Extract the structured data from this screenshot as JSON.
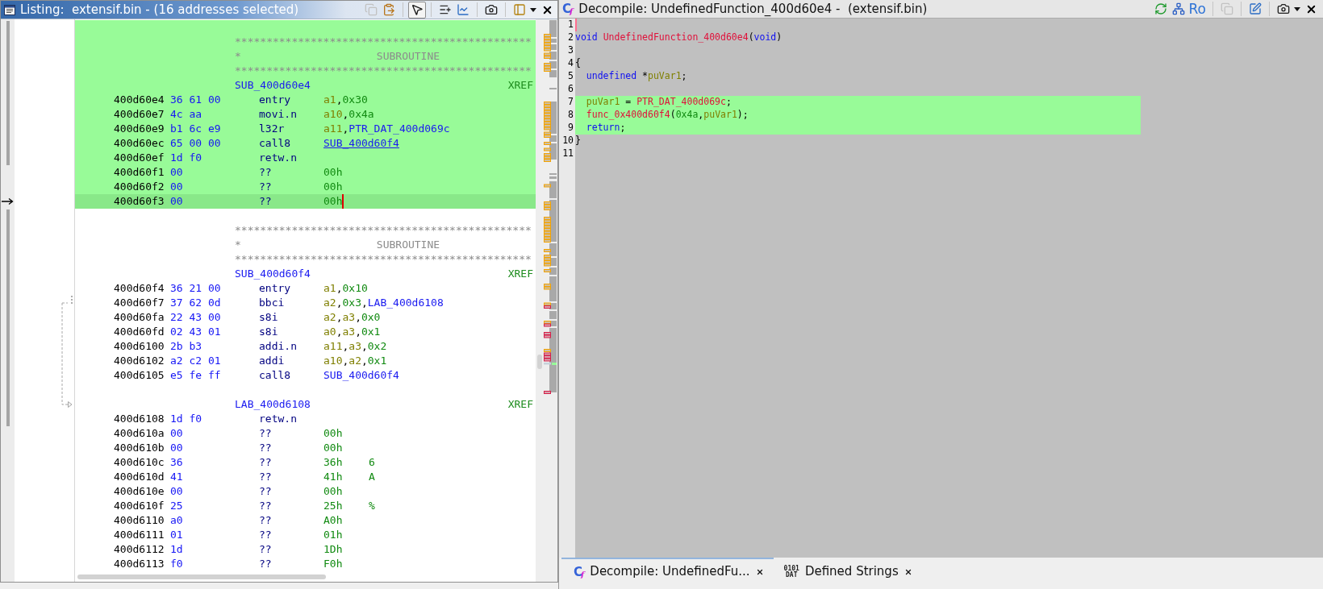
{
  "listing": {
    "title": "Listing:  extensif.bin - (16 addresses selected)",
    "toolbar": [
      {
        "disabled": true,
        "pressed": false
      },
      {
        "disabled": false,
        "pressed": false
      },
      {
        "disabled": false,
        "pressed": true
      },
      {
        "disabled": false,
        "pressed": false
      },
      {
        "disabled": false,
        "pressed": false
      },
      {
        "disabled": false,
        "pressed": false
      },
      {
        "disabled": false,
        "pressed": false
      },
      {
        "disabled": false,
        "pressed": false
      },
      {
        "disabled": false,
        "pressed": false
      }
    ],
    "lines": [
      {
        "kind": "blank",
        "selected": true,
        "cursor": false
      },
      {
        "kind": "stars",
        "text": "***********************************************",
        "selected": true,
        "cursor": false
      },
      {
        "kind": "title",
        "mark": "*",
        "text": "SUBROUTINE",
        "selected": true,
        "cursor": false
      },
      {
        "kind": "stars",
        "text": "***********************************************",
        "selected": true,
        "cursor": false
      },
      {
        "kind": "label",
        "label": "SUB_400d60e4",
        "xref": "XREF",
        "selected": true,
        "cursor": false
      },
      {
        "kind": "code",
        "address": "400d60e4",
        "bytes": "36 61 00",
        "mnemonic": "entry",
        "operands": [
          {
            "kind": "register",
            "text": "a1"
          },
          {
            "kind": "separator",
            "text": ","
          },
          {
            "kind": "scalar",
            "text": "0x30"
          }
        ],
        "selected": true,
        "cursor": false
      },
      {
        "kind": "code",
        "address": "400d60e7",
        "bytes": "4c aa",
        "mnemonic": "movi.n",
        "operands": [
          {
            "kind": "register",
            "text": "a10"
          },
          {
            "kind": "separator",
            "text": ","
          },
          {
            "kind": "scalar",
            "text": "0x4a"
          }
        ],
        "selected": true,
        "cursor": false
      },
      {
        "kind": "code",
        "address": "400d60e9",
        "bytes": "b1 6c e9",
        "mnemonic": "l32r",
        "operands": [
          {
            "kind": "register",
            "text": "a11"
          },
          {
            "kind": "separator",
            "text": ","
          },
          {
            "kind": "label",
            "text": "PTR_DAT_400d069c"
          }
        ],
        "selected": true,
        "cursor": false
      },
      {
        "kind": "code",
        "address": "400d60ec",
        "bytes": "65 00 00",
        "mnemonic": "call8",
        "operands": [
          {
            "kind": "link",
            "text": "SUB_400d60f4"
          }
        ],
        "selected": true,
        "cursor": false
      },
      {
        "kind": "code",
        "address": "400d60ef",
        "bytes": "1d f0",
        "mnemonic": "retw.n",
        "selected": true,
        "cursor": false
      },
      {
        "kind": "code",
        "address": "400d60f1",
        "bytes": "00",
        "mnemonic": "??",
        "operands": [
          {
            "kind": "scalar",
            "text": "00h"
          }
        ],
        "selected": true,
        "cursor": false
      },
      {
        "kind": "code",
        "address": "400d60f2",
        "bytes": "00",
        "mnemonic": "??",
        "operands": [
          {
            "kind": "scalar",
            "text": "00h"
          }
        ],
        "selected": true,
        "cursor": false
      },
      {
        "kind": "code",
        "address": "400d60f3",
        "bytes": "00",
        "mnemonic": "??",
        "operands": [
          {
            "kind": "scalar",
            "text": "00h"
          }
        ],
        "selected": true,
        "cursor": true
      },
      {
        "kind": "blank",
        "selected": false,
        "cursor": false
      },
      {
        "kind": "stars",
        "text": "***********************************************",
        "selected": false,
        "cursor": false
      },
      {
        "kind": "title",
        "mark": "*",
        "text": "SUBROUTINE",
        "selected": false,
        "cursor": false
      },
      {
        "kind": "stars",
        "text": "***********************************************",
        "selected": false,
        "cursor": false
      },
      {
        "kind": "label",
        "label": "SUB_400d60f4",
        "xref": "XREF",
        "selected": false,
        "cursor": false
      },
      {
        "kind": "code",
        "address": "400d60f4",
        "bytes": "36 21 00",
        "mnemonic": "entry",
        "operands": [
          {
            "kind": "register",
            "text": "a1"
          },
          {
            "kind": "separator",
            "text": ","
          },
          {
            "kind": "scalar",
            "text": "0x10"
          }
        ],
        "selected": false,
        "cursor": false
      },
      {
        "kind": "code",
        "address": "400d60f7",
        "bytes": "37 62 0d",
        "mnemonic": "bbci",
        "operands": [
          {
            "kind": "register",
            "text": "a2"
          },
          {
            "kind": "separator",
            "text": ","
          },
          {
            "kind": "scalar",
            "text": "0x3"
          },
          {
            "kind": "separator",
            "text": ","
          },
          {
            "kind": "label",
            "text": "LAB_400d6108"
          }
        ],
        "selected": false,
        "cursor": false
      },
      {
        "kind": "code",
        "address": "400d60fa",
        "bytes": "22 43 00",
        "mnemonic": "s8i",
        "operands": [
          {
            "kind": "register",
            "text": "a2"
          },
          {
            "kind": "separator",
            "text": ","
          },
          {
            "kind": "register",
            "text": "a3"
          },
          {
            "kind": "separator",
            "text": ","
          },
          {
            "kind": "scalar",
            "text": "0x0"
          }
        ],
        "selected": false,
        "cursor": false
      },
      {
        "kind": "code",
        "address": "400d60fd",
        "bytes": "02 43 01",
        "mnemonic": "s8i",
        "operands": [
          {
            "kind": "register",
            "text": "a0"
          },
          {
            "kind": "separator",
            "text": ","
          },
          {
            "kind": "register",
            "text": "a3"
          },
          {
            "kind": "separator",
            "text": ","
          },
          {
            "kind": "scalar",
            "text": "0x1"
          }
        ],
        "selected": false,
        "cursor": false
      },
      {
        "kind": "code",
        "address": "400d6100",
        "bytes": "2b b3",
        "mnemonic": "addi.n",
        "operands": [
          {
            "kind": "register",
            "text": "a11"
          },
          {
            "kind": "separator",
            "text": ","
          },
          {
            "kind": "register",
            "text": "a3"
          },
          {
            "kind": "separator",
            "text": ","
          },
          {
            "kind": "scalar",
            "text": "0x2"
          }
        ],
        "selected": false,
        "cursor": false
      },
      {
        "kind": "code",
        "address": "400d6102",
        "bytes": "a2 c2 01",
        "mnemonic": "addi",
        "operands": [
          {
            "kind": "register",
            "text": "a10"
          },
          {
            "kind": "separator",
            "text": ","
          },
          {
            "kind": "register",
            "text": "a2"
          },
          {
            "kind": "separator",
            "text": ","
          },
          {
            "kind": "scalar",
            "text": "0x1"
          }
        ],
        "selected": false,
        "cursor": false
      },
      {
        "kind": "code",
        "address": "400d6105",
        "bytes": "e5 fe ff",
        "mnemonic": "call8",
        "operands": [
          {
            "kind": "label",
            "text": "SUB_400d60f4"
          }
        ],
        "selected": false,
        "cursor": false
      },
      {
        "kind": "blank",
        "selected": false,
        "cursor": false
      },
      {
        "kind": "label",
        "label": "LAB_400d6108",
        "xref": "XREF",
        "selected": false,
        "cursor": false
      },
      {
        "kind": "code",
        "address": "400d6108",
        "bytes": "1d f0",
        "mnemonic": "retw.n",
        "selected": false,
        "cursor": false
      },
      {
        "kind": "code",
        "address": "400d610a",
        "bytes": "00",
        "mnemonic": "??",
        "operands": [
          {
            "kind": "scalar",
            "text": "00h"
          }
        ],
        "selected": false,
        "cursor": false
      },
      {
        "kind": "code",
        "address": "400d610b",
        "bytes": "00",
        "mnemonic": "??",
        "operands": [
          {
            "kind": "scalar",
            "text": "00h"
          }
        ],
        "selected": false,
        "cursor": false
      },
      {
        "kind": "code",
        "address": "400d610c",
        "bytes": "36",
        "mnemonic": "??",
        "operands": [
          {
            "kind": "scalar",
            "text": "36h"
          }
        ],
        "char": "6",
        "selected": false,
        "cursor": false
      },
      {
        "kind": "code",
        "address": "400d610d",
        "bytes": "41",
        "mnemonic": "??",
        "operands": [
          {
            "kind": "scalar",
            "text": "41h"
          }
        ],
        "char": "A",
        "selected": false,
        "cursor": false
      },
      {
        "kind": "code",
        "address": "400d610e",
        "bytes": "00",
        "mnemonic": "??",
        "operands": [
          {
            "kind": "scalar",
            "text": "00h"
          }
        ],
        "selected": false,
        "cursor": false
      },
      {
        "kind": "code",
        "address": "400d610f",
        "bytes": "25",
        "mnemonic": "??",
        "operands": [
          {
            "kind": "scalar",
            "text": "25h"
          }
        ],
        "char": "%",
        "selected": false,
        "cursor": false
      },
      {
        "kind": "code",
        "address": "400d6110",
        "bytes": "a0",
        "mnemonic": "??",
        "operands": [
          {
            "kind": "scalar",
            "text": "A0h"
          }
        ],
        "selected": false,
        "cursor": false
      },
      {
        "kind": "code",
        "address": "400d6111",
        "bytes": "01",
        "mnemonic": "??",
        "operands": [
          {
            "kind": "scalar",
            "text": "01h"
          }
        ],
        "selected": false,
        "cursor": false
      },
      {
        "kind": "code",
        "address": "400d6112",
        "bytes": "1d",
        "mnemonic": "??",
        "operands": [
          {
            "kind": "scalar",
            "text": "1Dh"
          }
        ],
        "selected": false,
        "cursor": false
      },
      {
        "kind": "code",
        "address": "400d6113",
        "bytes": "f0",
        "mnemonic": "??",
        "operands": [
          {
            "kind": "scalar",
            "text": "F0h"
          }
        ],
        "selected": false,
        "cursor": false
      }
    ]
  },
  "decompile": {
    "icon": {
      "kind": "letters",
      "letter": "C",
      "sub": "f"
    },
    "title": "Decompile: UndefinedFunction_400d60e4 -  (extensif.bin)",
    "toolbar": [
      {
        "disabled": false
      },
      {
        "disabled": false
      },
      {
        "label": "Ro",
        "disabled": false
      },
      {
        "disabled": true
      },
      {
        "disabled": false
      },
      {
        "disabled": false
      },
      {
        "disabled": false
      },
      {
        "disabled": false
      }
    ],
    "lines": [
      {
        "number": "1",
        "selected": false,
        "cursor": true
      },
      {
        "number": "2",
        "tokens": [
          {
            "kind": "keyword",
            "text": "void "
          },
          {
            "kind": "function",
            "text": "UndefinedFunction_400d60e4"
          },
          {
            "kind": "plain",
            "text": "("
          },
          {
            "kind": "keyword",
            "text": "void"
          },
          {
            "kind": "plain",
            "text": ")"
          }
        ],
        "selected": false,
        "cursor": false
      },
      {
        "number": "3",
        "selected": false,
        "cursor": false
      },
      {
        "number": "4",
        "tokens": [
          {
            "kind": "plain",
            "text": "{"
          }
        ],
        "selected": false,
        "cursor": false,
        "children": [
          {
            "number": "5",
            "tokens": [
              {
                "kind": "keyword",
                "text": "undefined"
              },
              {
                "kind": "plain",
                "text": " *"
              },
              {
                "kind": "variable",
                "text": "puVar1"
              },
              {
                "kind": "plain",
                "text": ";"
              }
            ],
            "selected": false,
            "cursor": false
          },
          {
            "number": "6",
            "selected": false,
            "cursor": false
          },
          {
            "number": "7",
            "tokens": [
              {
                "kind": "variable",
                "text": "puVar1"
              },
              {
                "kind": "plain",
                "text": " = "
              },
              {
                "kind": "global",
                "text": "PTR_DAT_400d069c"
              },
              {
                "kind": "plain",
                "text": ";"
              }
            ],
            "selected": true,
            "cursor": false
          },
          {
            "number": "8",
            "tokens": [
              {
                "kind": "function",
                "text": "func_0x400d60f4"
              },
              {
                "kind": "plain",
                "text": "("
              },
              {
                "kind": "constant",
                "text": "0x4a"
              },
              {
                "kind": "plain",
                "text": ","
              },
              {
                "kind": "variable",
                "text": "puVar1"
              },
              {
                "kind": "plain",
                "text": ");"
              }
            ],
            "selected": true,
            "cursor": false
          },
          {
            "number": "9",
            "tokens": [
              {
                "kind": "keyword",
                "text": "return"
              },
              {
                "kind": "plain",
                "text": ";"
              }
            ],
            "selected": true,
            "cursor": false
          }
        ]
      },
      {
        "number": "10",
        "tokens": [
          {
            "kind": "plain",
            "text": "}"
          }
        ],
        "selected": false,
        "cursor": false
      },
      {
        "number": "11",
        "selected": false,
        "cursor": false
      }
    ]
  },
  "tabs": [
    {
      "label": "Decompile: UndefinedFu...",
      "selected": true,
      "icon": {
        "kind": "letters",
        "letter": "C",
        "sub": "f"
      }
    },
    {
      "label": "Defined Strings",
      "selected": false,
      "icon": {
        "kind": "stacked",
        "lines": [
          "0101",
          "DAT"
        ]
      }
    }
  ]
}
